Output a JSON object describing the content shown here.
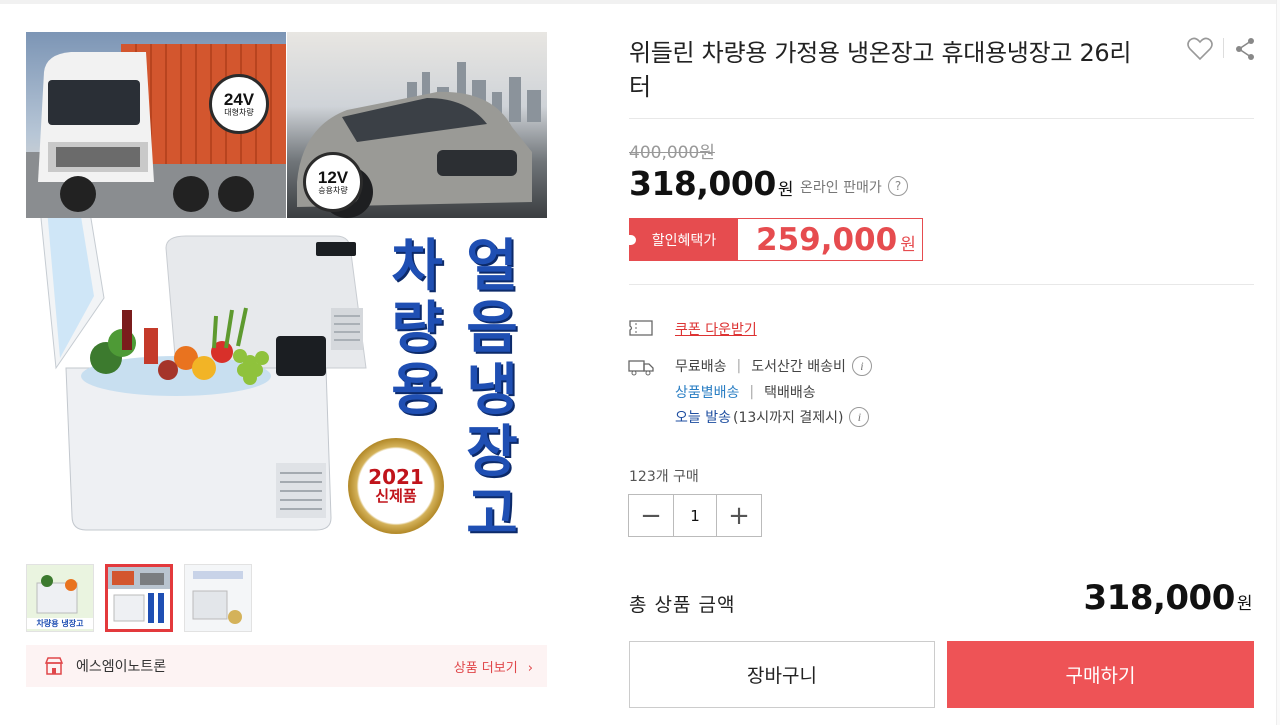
{
  "product": {
    "title": "위들린 차량용 가정용 냉온장고 휴대용냉장고 26리터",
    "original_price": "400,000원",
    "sale_price": "318,000",
    "currency": "원",
    "online_label": "온라인 판매가",
    "discount_label": "할인혜택가",
    "discount_price": "259,000"
  },
  "main_image": {
    "badge_truck_voltage": "24V",
    "badge_truck_text": "대형차량",
    "badge_car_voltage": "12V",
    "badge_car_text": "승용차량",
    "vertical_col1": [
      "차",
      "량",
      "용"
    ],
    "vertical_col2": [
      "얼",
      "음",
      "냉",
      "장",
      "고"
    ],
    "seal_year": "2021",
    "seal_text": "신제품"
  },
  "thumbnails": [
    {
      "caption": "차량용 냉장고",
      "active": false
    },
    {
      "caption": "",
      "active": true
    },
    {
      "caption": "",
      "active": false
    }
  ],
  "seller": {
    "name": "에스엠이노트론",
    "more_label": "상품 더보기"
  },
  "benefits": {
    "coupon_label": "쿠폰 다운받기"
  },
  "shipping": {
    "free": "무료배송",
    "island_fee": "도서산간 배송비",
    "per_product": "상품별배송",
    "parcel": "택배배송",
    "today": "오늘 발송",
    "today_note": "(13시까지 결제시)"
  },
  "purchase": {
    "sold_count": "123개 구매",
    "quantity": "1",
    "total_label": "총 상품 금액",
    "total_price": "318,000"
  },
  "actions": {
    "cart_label": "장바구니",
    "buy_label": "구매하기"
  },
  "colors": {
    "accent": "#ee5356",
    "discount": "#e64c4f",
    "link_blue": "#2b7fc4",
    "title_blue": "#1f4fb3"
  }
}
